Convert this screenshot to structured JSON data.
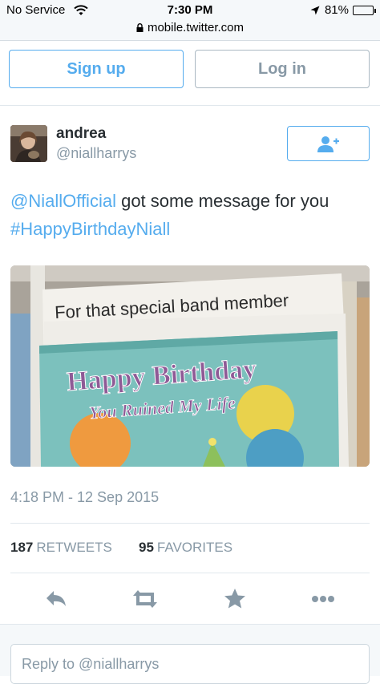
{
  "status_bar": {
    "carrier": "No Service",
    "time": "7:30 PM",
    "battery": "81%",
    "battery_level": 0.81,
    "url": "mobile.twitter.com"
  },
  "auth": {
    "signup_label": "Sign up",
    "login_label": "Log in"
  },
  "tweet": {
    "name": "andrea",
    "handle": "@niallharrys",
    "mention": "@NiallOfficial",
    "text": " got some message for you ",
    "hashtag": "#HappyBirthdayNiall",
    "photo": {
      "line1": "For that special band member",
      "line2": "Happy Birthday",
      "line3": "You Ruined My Life"
    },
    "timestamp": "4:18 PM - 12 Sep 2015",
    "retweets_count": "187",
    "retweets_label": "RETWEETS",
    "favorites_count": "95",
    "favorites_label": "FAVORITES"
  },
  "reply": {
    "placeholder": "Reply to @niallharrys"
  },
  "icons": [
    "wifi-icon",
    "location-arrow-icon",
    "lock-icon",
    "follow-icon",
    "reply-icon",
    "retweet-icon",
    "favorite-icon",
    "more-icon"
  ],
  "colors": {
    "accent": "#55acee",
    "muted": "#8899a6",
    "text": "#292f33"
  }
}
